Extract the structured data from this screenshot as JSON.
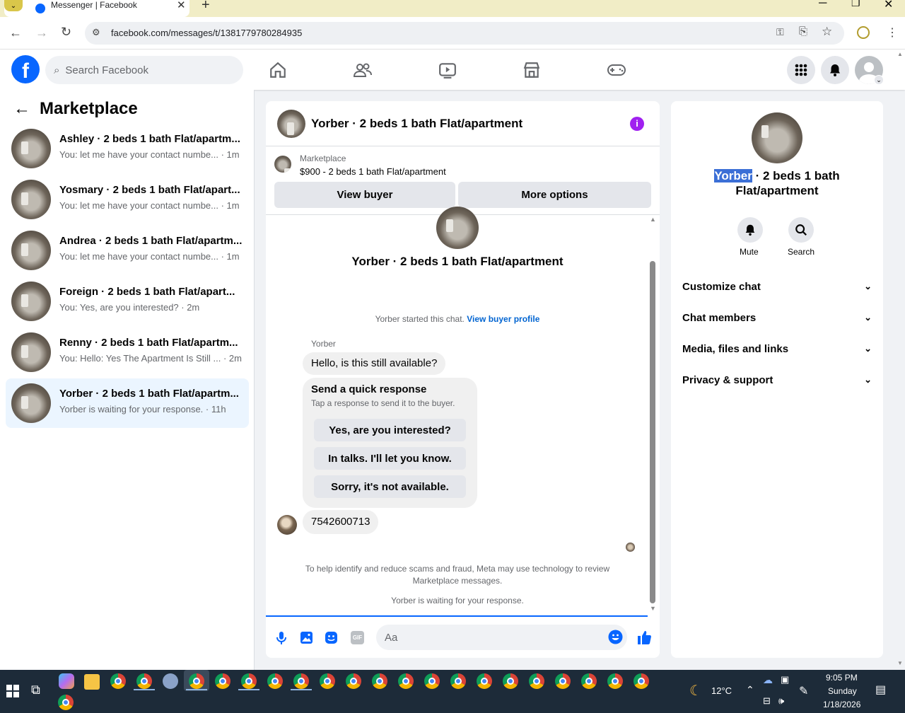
{
  "browser": {
    "tab_title": "Messenger | Facebook",
    "url": "facebook.com/messages/t/1381779780284935"
  },
  "header": {
    "search_placeholder": "Search Facebook"
  },
  "sidebar": {
    "title": "Marketplace",
    "conversations": [
      {
        "name": "Ashley · 2 beds 1 bath Flat/apartm...",
        "preview": "You: let me have your contact numbe... · 1m"
      },
      {
        "name": "Yosmary · 2 beds 1 bath Flat/apart...",
        "preview": "You: let me have your contact numbe... · 1m"
      },
      {
        "name": "Andrea · 2 beds 1 bath Flat/apartm...",
        "preview": "You: let me have your contact numbe... · 1m"
      },
      {
        "name": "Foreign · 2 beds 1 bath Flat/apart...",
        "preview": "You: Yes, are you interested? · 2m"
      },
      {
        "name": "Renny · 2 beds 1 bath Flat/apartm...",
        "preview": "You: Hello: Yes The Apartment Is Still ... · 2m"
      },
      {
        "name": "Yorber · 2 beds 1 bath Flat/apartm...",
        "preview": "Yorber is waiting for your response. · 11h"
      }
    ]
  },
  "chat": {
    "header_title": "Yorber · 2 beds 1 bath Flat/apartment",
    "listing_label": "Marketplace",
    "listing_title": "$900 - 2 beds 1 bath Flat/apartment",
    "view_buyer": "View buyer",
    "more_options": "More options",
    "intro_title": "Yorber · 2 beds 1 bath Flat/apartment",
    "started_text": "Yorber started this chat.",
    "view_buyer_profile": "View buyer profile",
    "sender_name": "Yorber",
    "message_1": "Hello, is this still available?",
    "quick_title": "Send a quick response",
    "quick_sub": "Tap a response to send it to the buyer.",
    "quick_responses": [
      "Yes, are you interested?",
      "In talks. I'll let you know.",
      "Sorry, it's not available."
    ],
    "message_2": "7542600713",
    "scam_notice": "To help identify and reduce scams and fraud, Meta may use technology to review Marketplace messages.",
    "waiting": "Yorber is waiting for your response.",
    "composer_placeholder": "Aa",
    "accent": "#0866ff"
  },
  "details": {
    "name_highlight": "Yorber",
    "name_rest": " · 2 beds 1 bath",
    "name_line2": "Flat/apartment",
    "mute": "Mute",
    "search": "Search",
    "sections": [
      "Customize chat",
      "Chat members",
      "Media, files and links",
      "Privacy & support"
    ]
  },
  "taskbar": {
    "temp": "12°C",
    "time": "9:05 PM",
    "day": "Sunday",
    "date": "1/18/2026"
  }
}
